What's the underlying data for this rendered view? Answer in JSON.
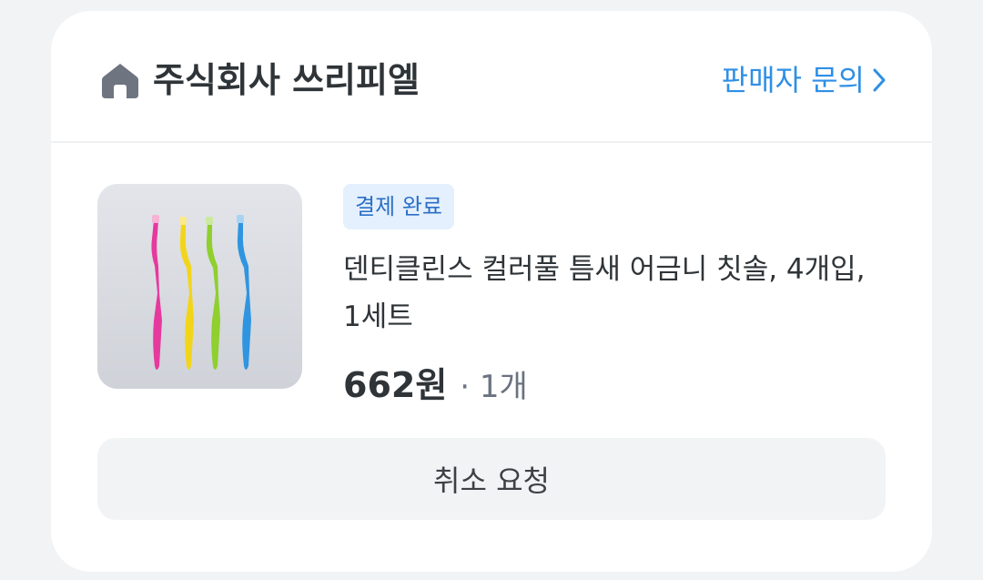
{
  "store": {
    "icon": "store-home-icon",
    "name": "주식회사 쓰리피엘",
    "inquiry_label": "판매자 문의",
    "inquiry_icon": "chevron-right-icon"
  },
  "order": {
    "status_badge": "결제 완료",
    "product_name": "덴티클린스 컬러풀 틈새 어금니 칫솔, 4개입, 1세트",
    "price": "662원",
    "quantity": "· 1개",
    "cancel_label": "취소 요청"
  },
  "colors": {
    "accent": "#2f8fe6",
    "badge_bg": "#e4f0fd",
    "badge_text": "#2b6fc6",
    "button_bg": "#f2f3f5",
    "toothbrush_colors": [
      "#e6399e",
      "#f2d51a",
      "#8fcf2e",
      "#2f95e0"
    ]
  }
}
